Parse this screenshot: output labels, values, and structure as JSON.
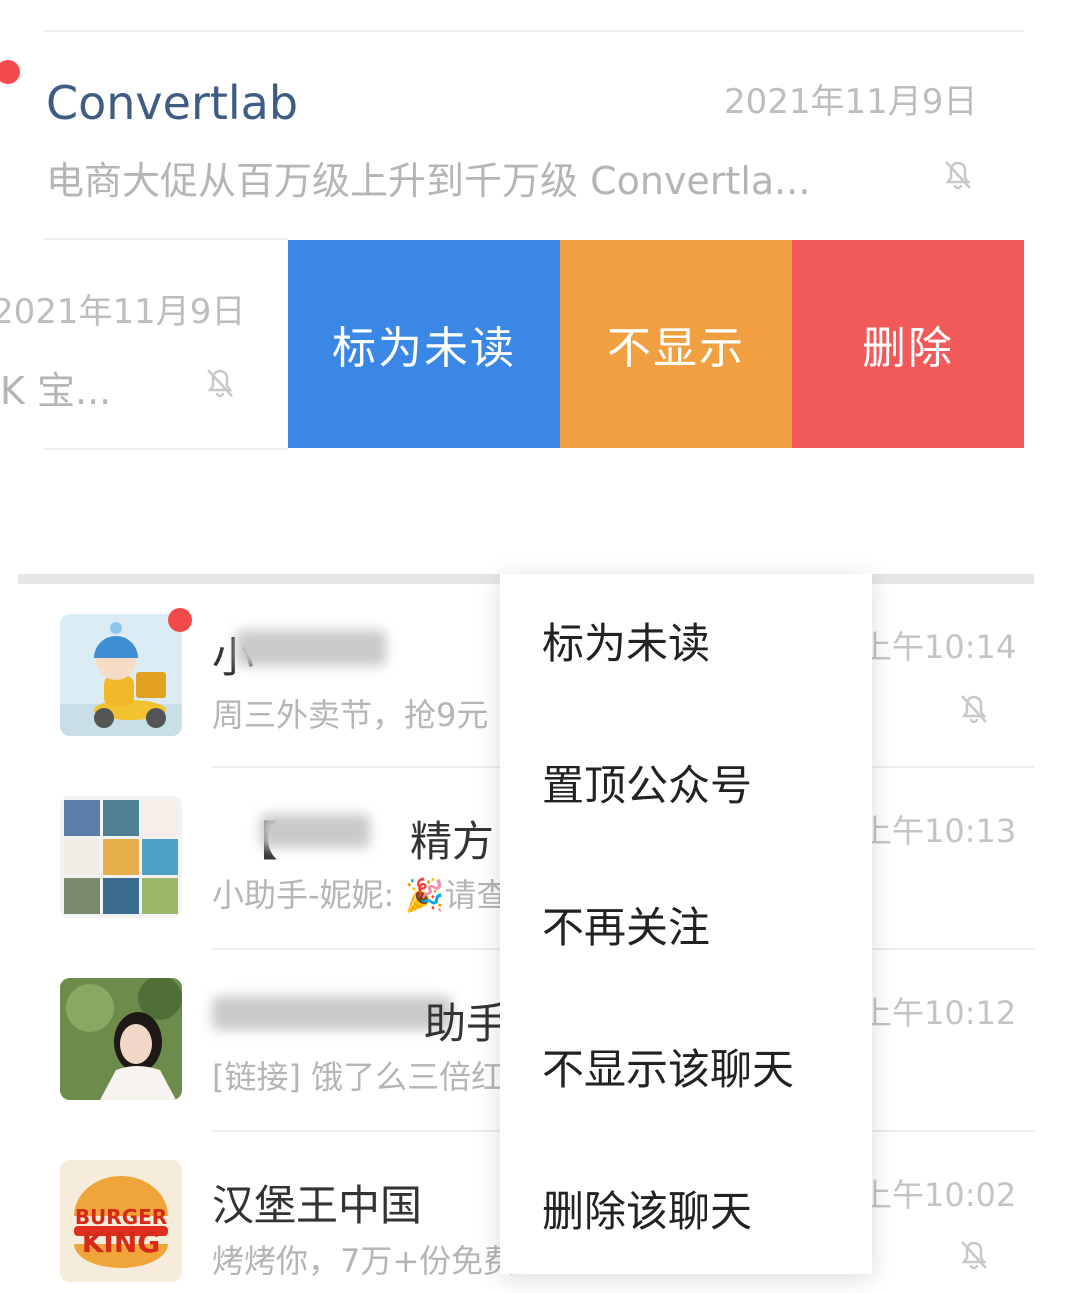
{
  "top_conversation": {
    "title": "Convertlab",
    "date": "2021年11月9日",
    "preview": "电商大促从百万级上升到千万级  Convertla..."
  },
  "swiped_conversation": {
    "date": "2021年11月9日",
    "preview": "K 宝..."
  },
  "swipe_actions": {
    "mark_unread": "标为未读",
    "hide": "不显示",
    "delete": "删除",
    "colors": {
      "mark_unread": "#3a87e6",
      "hide": "#f0a040",
      "delete": "#f25a5a"
    }
  },
  "chats": [
    {
      "name": "小",
      "message": "周三外卖节，抢9元",
      "time": "上午10:14",
      "muted": true,
      "unread": true
    },
    {
      "name": "【",
      "name_tail": "精方",
      "message": "小助手-妮妮: 🎉请查",
      "time": "上午10:13",
      "muted": false,
      "unread": false
    },
    {
      "name_tail": "助手",
      "message": "[链接] 饿了么三倍红",
      "time": "上午10:12",
      "muted": false,
      "unread": false
    },
    {
      "name": "汉堡王中国",
      "message": "烤烤你，7万+份免费",
      "time": "上午10:02",
      "muted": true,
      "unread": false
    }
  ],
  "burger_king_logo": {
    "line1": "BURGER",
    "line2": "KING"
  },
  "context_menu": {
    "items": [
      "标为未读",
      "置顶公众号",
      "不再关注",
      "不显示该聊天",
      "删除该聊天"
    ]
  }
}
